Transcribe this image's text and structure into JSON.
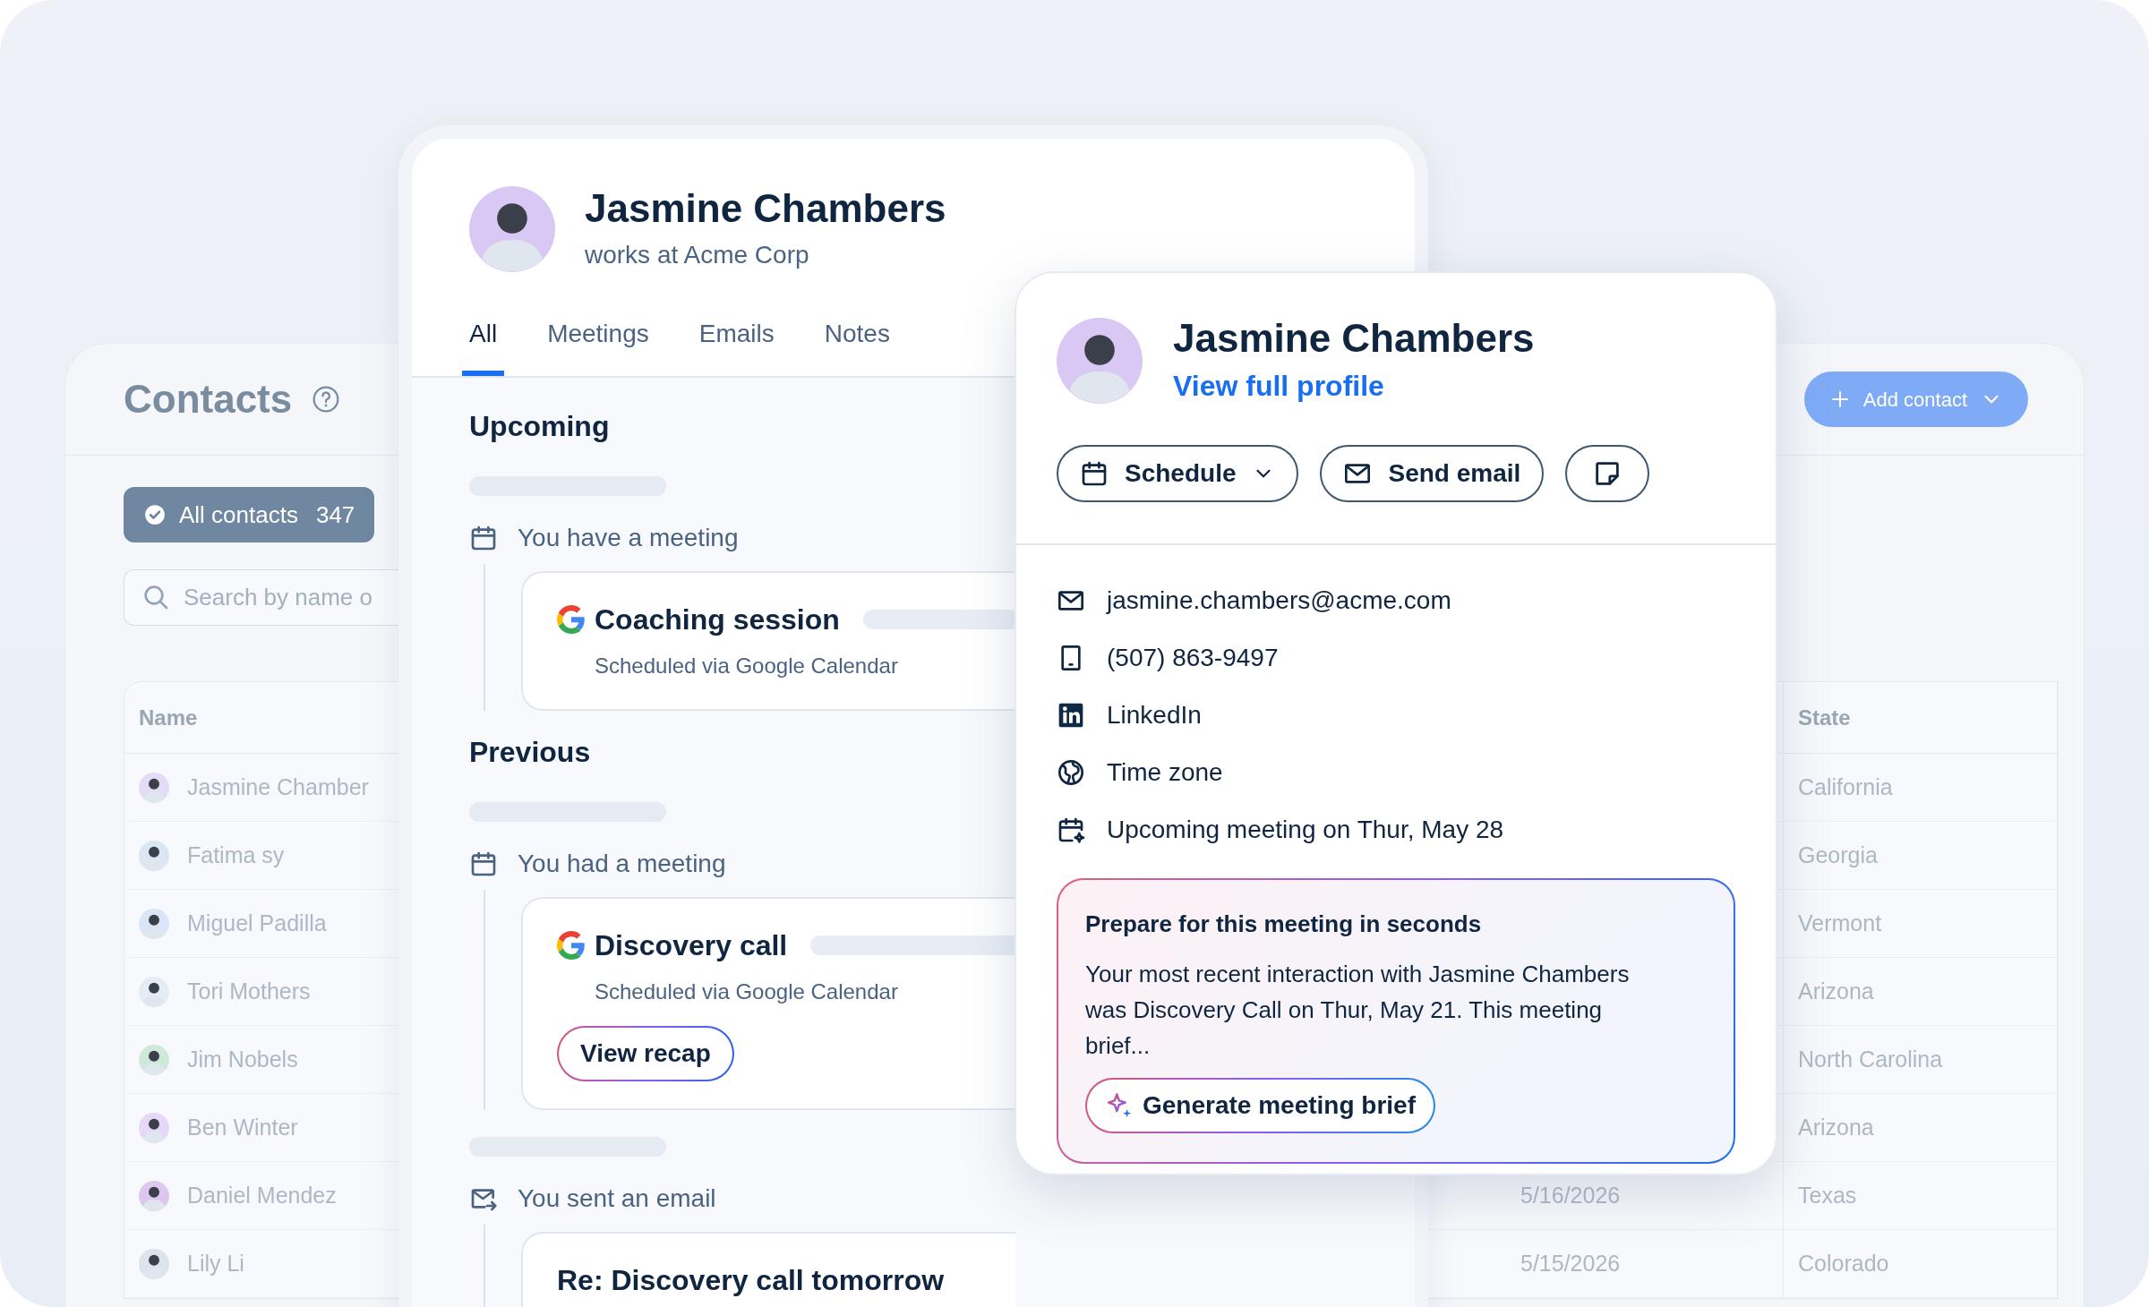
{
  "contacts": {
    "title": "Contacts",
    "filter": {
      "label": "All contacts",
      "count": "347",
      "selected": true
    },
    "search": {
      "placeholder": "Search by name o"
    },
    "add_button": {
      "label": "Add contact"
    },
    "table": {
      "columns": [
        "Name",
        "State"
      ],
      "rows": [
        {
          "name": "Jasmine Chamber",
          "state": "California"
        },
        {
          "name": "Fatima sy",
          "state": "Georgia"
        },
        {
          "name": "Miguel Padilla",
          "state": "Vermont"
        },
        {
          "name": "Tori Mothers",
          "state": "Arizona"
        },
        {
          "name": "Jim Nobels",
          "state": "North Carolina"
        },
        {
          "name": "Ben Winter",
          "state": "Arizona"
        },
        {
          "name": "Daniel Mendez",
          "date": "5/16/2026",
          "state": "Texas"
        },
        {
          "name": "Lily Li",
          "date": "5/15/2026",
          "state": "Colorado"
        }
      ]
    }
  },
  "activity": {
    "name": "Jasmine Chambers",
    "subtitle": "works at Acme Corp",
    "tabs": [
      {
        "label": "All",
        "selected": true
      },
      {
        "label": "Meetings",
        "selected": false
      },
      {
        "label": "Emails",
        "selected": false
      },
      {
        "label": "Notes",
        "selected": false
      }
    ],
    "sections": [
      {
        "title": "Upcoming",
        "items": [
          {
            "kind": "meeting",
            "label": "You have a meeting",
            "title": "Coaching session",
            "source": "Scheduled via Google Calendar"
          }
        ]
      },
      {
        "title": "Previous",
        "items": [
          {
            "kind": "meeting",
            "label": "You had a meeting",
            "title": "Discovery call",
            "source": "Scheduled via Google Calendar",
            "button": "View recap"
          },
          {
            "kind": "email",
            "label": "You sent an email",
            "title": "Re: Discovery call tomorrow"
          }
        ]
      }
    ]
  },
  "profile_card": {
    "name": "Jasmine Chambers",
    "link": "View full profile",
    "actions": [
      {
        "kind": "schedule",
        "label": "Schedule"
      },
      {
        "kind": "email",
        "label": "Send email"
      },
      {
        "kind": "note"
      }
    ],
    "details": [
      {
        "kind": "email",
        "text": "jasmine.chambers@acme.com"
      },
      {
        "kind": "phone",
        "text": "(507) 863-9497"
      },
      {
        "kind": "linkedin",
        "text": "LinkedIn"
      },
      {
        "kind": "timezone",
        "text": "Time zone"
      },
      {
        "kind": "meeting",
        "text": "Upcoming meeting on Thur, May 28"
      }
    ],
    "brief": {
      "title": "Prepare for this meeting in seconds",
      "text": "Your most recent interaction with Jasmine Chambers was Discovery Call on Thur, May 21. This meeting brief...",
      "button": "Generate meeting brief"
    }
  }
}
